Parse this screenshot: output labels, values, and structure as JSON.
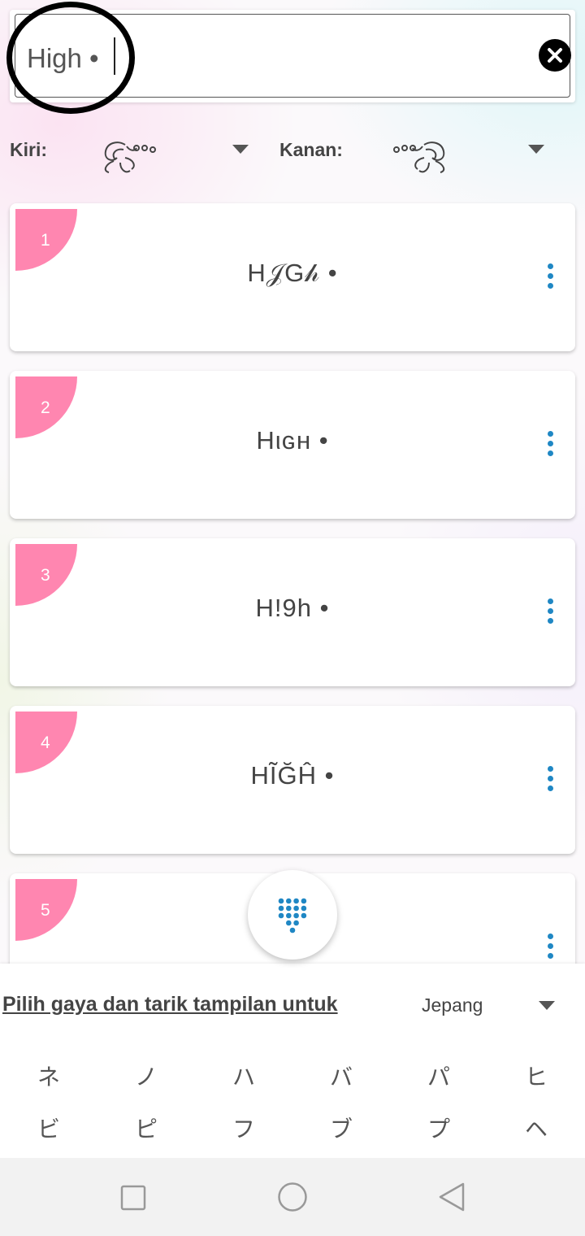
{
  "search": {
    "value": "High •"
  },
  "decorations": {
    "left_label": "Kiri:",
    "right_label": "Kanan:"
  },
  "results": [
    {
      "number": "1",
      "text": "H𝒥G𝒽 •"
    },
    {
      "number": "2",
      "text": "Hιɢʜ •"
    },
    {
      "number": "3",
      "text": "H!9h •"
    },
    {
      "number": "4",
      "text": "HĨĞĤ •"
    },
    {
      "number": "5",
      "text": ""
    }
  ],
  "panel": {
    "hint": "Pilih gaya dan tarik tampilan untuk",
    "language": "Jepang",
    "kana_row1": [
      "ネ",
      "ノ",
      "ハ",
      "バ",
      "パ",
      "ヒ"
    ],
    "kana_row2": [
      "ビ",
      "ピ",
      "フ",
      "ブ",
      "プ",
      "ヘ"
    ]
  },
  "colors": {
    "badge": "#ff86b0",
    "accent": "#1f87c4"
  },
  "icons": [
    "close-icon",
    "chevron-down-icon",
    "more-vert-icon",
    "dialpad-icon",
    "recents-icon",
    "home-icon",
    "back-icon"
  ]
}
